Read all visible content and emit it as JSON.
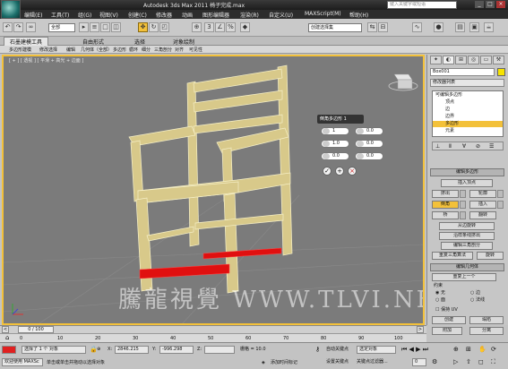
{
  "title_bar": {
    "title": "Autodesk 3ds Max  2011     椅子完成.max",
    "search_placeholder": "键入关键字或短语",
    "window_buttons": [
      "_",
      "□",
      "×"
    ]
  },
  "menu": [
    "编辑(E)",
    "工具(T)",
    "组(G)",
    "视图(V)",
    "创建(C)",
    "修改器",
    "动画",
    "图形编辑器",
    "渲染(R)",
    "自定义(U)",
    "MAXScript(M)",
    "帮助(H)"
  ],
  "toolbar": {
    "filter_select": "全部",
    "create_selection_set": "创建选择集",
    "active_tool": "move"
  },
  "ribbon": {
    "tabs": [
      "石墨建模工具",
      "自由形式",
      "选择",
      "对象绘制"
    ],
    "subtabs": [
      "多边形建模",
      "修改选择",
      "编辑",
      "几何体（全部）",
      "多边形",
      "循环",
      "细分",
      "三角剖分",
      "对齐",
      "可见性"
    ]
  },
  "viewport": {
    "label": "[ + ] [ 透视 ] [ 平滑 + 高光 + 边面 ]",
    "watermark": "騰龍視覺  WWW.TLVI.NET"
  },
  "caddy": {
    "title": "倒角多边形 1",
    "fields": [
      {
        "icon": "bevel-type-icon",
        "value": "1"
      },
      {
        "icon": "height-icon",
        "value": "0.0"
      },
      {
        "icon": "outline-icon",
        "value": "1.0"
      },
      {
        "icon": "outline-amount-icon",
        "value": "0.0"
      },
      {
        "icon": "tension-icon",
        "value": "0.0"
      },
      {
        "icon": "segments-icon",
        "value": "0.0"
      }
    ]
  },
  "command_panel": {
    "object_name": "Box001",
    "modifier_list": "修改器列表",
    "stack": [
      "可编辑多边形",
      "顶点",
      "边",
      "边界",
      "多边形",
      "元素"
    ],
    "stack_selected": 4,
    "rollout_edit_polygons": {
      "title": "编辑多边形",
      "insert_vertex": "插入顶点",
      "buttons": [
        [
          "挤出",
          "轮廓"
        ],
        [
          "倒角",
          "插入"
        ],
        [
          "桥",
          "翻转"
        ]
      ],
      "hinge": "从边旋转",
      "extrude_spline": "沿样条线挤出",
      "edit_tri": "编辑三角剖分",
      "retri": "重复三角算法",
      "turn": "旋转"
    },
    "rollout_edit_geometry": {
      "title": "编辑几何体",
      "repeat_last": "重复上一个",
      "constraints": "约束",
      "radio": [
        [
          "无",
          "边"
        ],
        [
          "面",
          "法线"
        ]
      ],
      "preserve_uv": "保持 UV",
      "create": "创建",
      "collapse": "塌陷",
      "attach": "附加",
      "detach": "分离"
    }
  },
  "timeline": {
    "frame": "0 / 100",
    "ticks": [
      "0",
      "10",
      "20",
      "30",
      "40",
      "50",
      "60",
      "70",
      "80",
      "90",
      "100"
    ]
  },
  "status": {
    "selection": "选择了 1 个 对象",
    "x": "2846.215",
    "y": "-996.298",
    "z": "",
    "grid": "栅格 = 10.0",
    "autokey": "自动关键点",
    "setkey": "设置关键点",
    "selected_object": "选定对象",
    "key_filters": "关键点过滤器...",
    "welcome": "欢迎使用 MAXSc",
    "prompt": "单击或单击并拖动以选择对象",
    "add_time_tag": "添加时间标记"
  },
  "colors": {
    "chair_fill": "#d8c98a",
    "chair_edge": "#f6f0c8",
    "selected_polys": "#e01010",
    "viewport_bg": "#7b7b7b",
    "active_border": "#f3c13a"
  }
}
